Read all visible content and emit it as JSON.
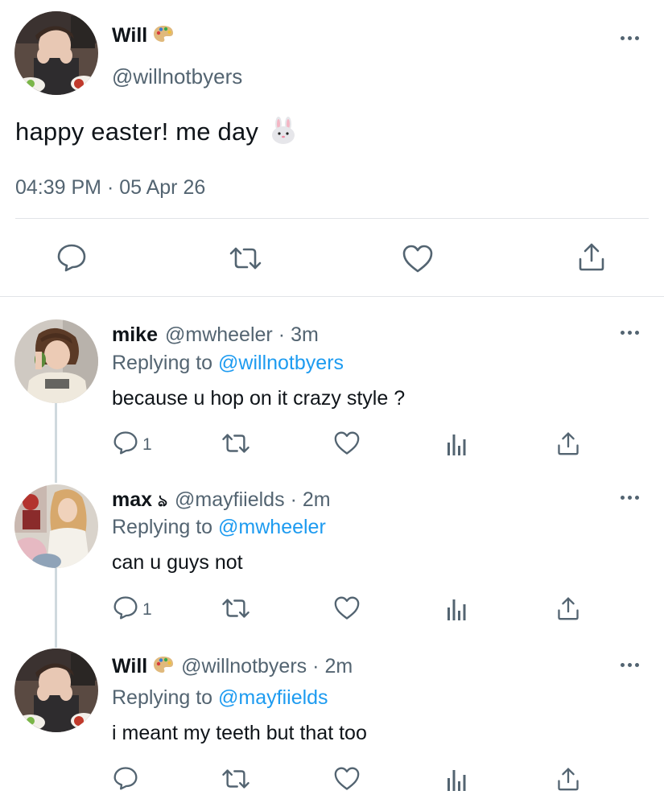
{
  "main_tweet": {
    "author_name": "Will",
    "author_emoji": "palette-icon",
    "author_handle": "@willnotbyers",
    "text": "happy easter! me day",
    "text_emoji": "rabbit-face-icon",
    "timestamp": "04:39 PM · 05 Apr 26",
    "actions": [
      "reply-icon",
      "retweet-icon",
      "like-icon",
      "share-icon"
    ]
  },
  "replies": [
    {
      "name": "mike",
      "handle": "@mwheeler",
      "dot": "·",
      "time": "3m",
      "replying_prefix": "Replying to",
      "replying_to": "@willnotbyers",
      "text": "because u hop on it crazy style ?",
      "reply_count": "1"
    },
    {
      "name": "max",
      "name_symbol": "ঌ",
      "handle": "@mayfiields",
      "dot": "·",
      "time": "2m",
      "replying_prefix": "Replying to",
      "replying_to": "@mwheeler",
      "text": "can u guys not",
      "reply_count": "1"
    },
    {
      "name": "Will",
      "name_emoji": "palette-icon",
      "handle": "@willnotbyers",
      "dot": "·",
      "time": "2m",
      "replying_prefix": "Replying to",
      "replying_to": "@mayfiields",
      "text": "i meant my teeth but that too",
      "reply_count": ""
    }
  ],
  "colors": {
    "text_primary": "#0f1419",
    "text_secondary": "#536471",
    "link": "#1d9bf0",
    "divider": "#e1e4e7",
    "thread_line": "#cfd9de"
  }
}
